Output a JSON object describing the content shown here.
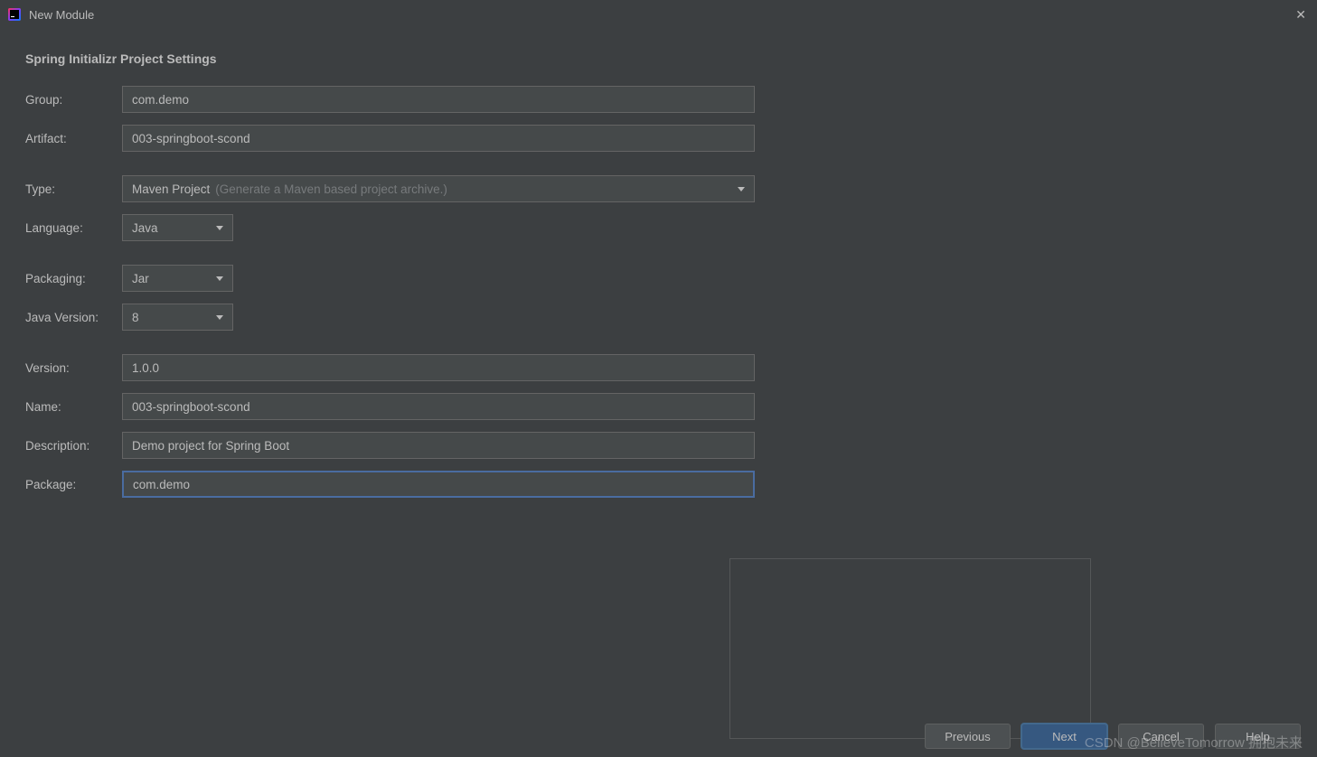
{
  "titlebar": {
    "title": "New Module"
  },
  "heading": "Spring Initializr Project Settings",
  "form": {
    "group": {
      "label": "Group:",
      "value": "com.demo"
    },
    "artifact": {
      "label": "Artifact:",
      "value": "003-springboot-scond"
    },
    "type": {
      "label": "Type:",
      "value": "Maven Project",
      "hint": "(Generate a Maven based project archive.)"
    },
    "language": {
      "label": "Language:",
      "value": "Java"
    },
    "packaging": {
      "label": "Packaging:",
      "value": "Jar"
    },
    "javaVersion": {
      "label": "Java Version:",
      "value": "8"
    },
    "version": {
      "label": "Version:",
      "value": "1.0.0"
    },
    "name": {
      "label": "Name:",
      "value": "003-springboot-scond"
    },
    "description": {
      "label": "Description:",
      "value": "Demo project for Spring Boot"
    },
    "package": {
      "label": "Package:",
      "value": "com.demo"
    }
  },
  "buttons": {
    "previous": "Previous",
    "next": "Next",
    "cancel": "Cancel",
    "help": "Help"
  },
  "watermark": "CSDN @BelieveTomorrow 拥抱未来"
}
